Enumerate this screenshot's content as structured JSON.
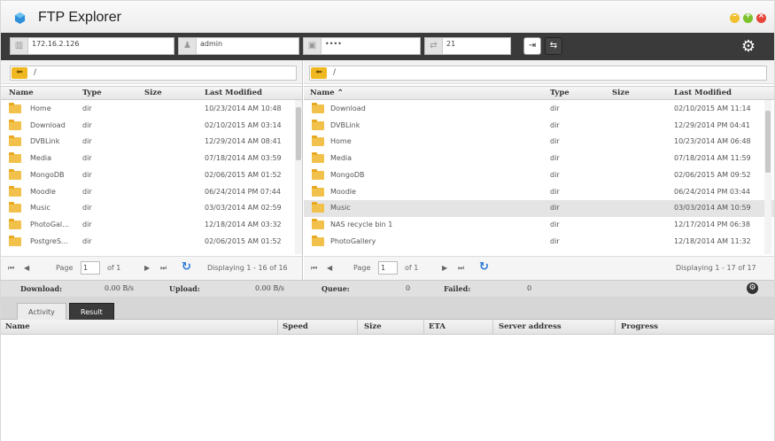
{
  "app": {
    "title": "FTP Explorer"
  },
  "connection": {
    "host": "172.16.2.126",
    "user": "admin",
    "password": "••••",
    "port": "21"
  },
  "left_pane": {
    "path": "/",
    "columns": [
      "Name",
      "Type",
      "Size",
      "Last Modified"
    ],
    "rows": [
      {
        "name": "Home",
        "type": "dir",
        "size": "",
        "modified": "10/23/2014 AM 10:48"
      },
      {
        "name": "Download",
        "type": "dir",
        "size": "",
        "modified": "02/10/2015 AM 03:14"
      },
      {
        "name": "DVBLink",
        "type": "dir",
        "size": "",
        "modified": "12/29/2014 AM 08:41"
      },
      {
        "name": "Media",
        "type": "dir",
        "size": "",
        "modified": "07/18/2014 AM 03:59"
      },
      {
        "name": "MongoDB",
        "type": "dir",
        "size": "",
        "modified": "02/06/2015 AM 01:52"
      },
      {
        "name": "Moodle",
        "type": "dir",
        "size": "",
        "modified": "06/24/2014 PM 07:44"
      },
      {
        "name": "Music",
        "type": "dir",
        "size": "",
        "modified": "03/03/2014 AM 02:59"
      },
      {
        "name": "PhotoGal...",
        "type": "dir",
        "size": "",
        "modified": "12/18/2014 AM 03:32"
      },
      {
        "name": "PostgreS...",
        "type": "dir",
        "size": "",
        "modified": "02/06/2015 AM 01:52"
      }
    ],
    "pager": {
      "page_label": "Page",
      "page": "1",
      "of": "of 1",
      "display": "Displaying 1 - 16 of 16"
    }
  },
  "right_pane": {
    "path": "/",
    "columns": [
      "Name ⌃",
      "Type",
      "Size",
      "Last Modified"
    ],
    "rows": [
      {
        "name": "Download",
        "type": "dir",
        "size": "",
        "modified": "02/10/2015 AM 11:14"
      },
      {
        "name": "DVBLink",
        "type": "dir",
        "size": "",
        "modified": "12/29/2014 PM 04:41"
      },
      {
        "name": "Home",
        "type": "dir",
        "size": "",
        "modified": "10/23/2014 AM 06:48"
      },
      {
        "name": "Media",
        "type": "dir",
        "size": "",
        "modified": "07/18/2014 AM 11:59"
      },
      {
        "name": "MongoDB",
        "type": "dir",
        "size": "",
        "modified": "02/06/2015 AM 09:52"
      },
      {
        "name": "Moodle",
        "type": "dir",
        "size": "",
        "modified": "06/24/2014 PM 03:44"
      },
      {
        "name": "Music",
        "type": "dir",
        "size": "",
        "modified": "03/03/2014 AM 10:59"
      },
      {
        "name": "NAS recycle bin 1",
        "type": "dir",
        "size": "",
        "modified": "12/17/2014 PM 06:38"
      },
      {
        "name": "PhotoGallery",
        "type": "dir",
        "size": "",
        "modified": "12/18/2014 AM 11:32"
      }
    ],
    "selected_row": 6,
    "pager": {
      "page_label": "Page",
      "page": "1",
      "of": "of 1",
      "display": "Displaying 1 - 17 of 17"
    }
  },
  "status": {
    "download_label": "Download:",
    "download_value": "0.00 B/s",
    "upload_label": "Upload:",
    "upload_value": "0.00 B/s",
    "queue_label": "Queue:",
    "queue_value": "0",
    "failed_label": "Failed:",
    "failed_value": "0"
  },
  "tabs": {
    "activity": "Activity",
    "result": "Result"
  },
  "queue_columns": [
    "Name",
    "Speed",
    "Size",
    "ETA",
    "Server address",
    "Progress"
  ],
  "colors": {
    "accent": "#2a7ad6",
    "folder": "#f2c14b",
    "toolbar": "#3a3a3a"
  }
}
